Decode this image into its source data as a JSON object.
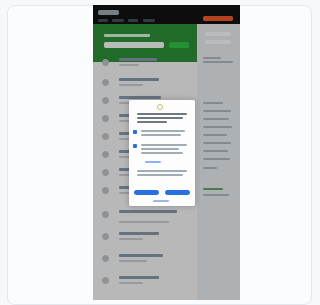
{
  "frame": {
    "colors": {
      "topbar": "#111111",
      "hero": "#2c8a36",
      "cta": "#e8572a",
      "primary": "#2870e0",
      "overlay": "rgba(0,0,0,0.22)"
    }
  },
  "icons": {
    "logo": "logo-icon",
    "dialog": "circle-icon",
    "checkbox": "checkbox-icon",
    "avatar": "avatar-icon"
  },
  "modal": {
    "heading": "",
    "option_1": "",
    "option_2": "",
    "link": "",
    "accept_label": "",
    "reject_label": "",
    "footer_link": ""
  }
}
